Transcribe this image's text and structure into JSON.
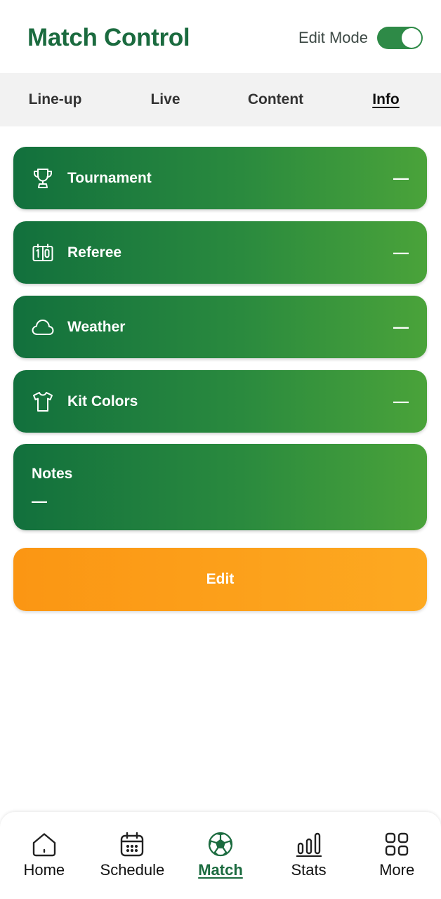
{
  "header": {
    "title": "Match Control",
    "edit_mode_label": "Edit Mode",
    "edit_mode_on": true
  },
  "tabs": [
    {
      "label": "Line-up",
      "active": false
    },
    {
      "label": "Live",
      "active": false
    },
    {
      "label": "Content",
      "active": false
    },
    {
      "label": "Info",
      "active": true
    }
  ],
  "info_cards": [
    {
      "icon": "trophy-icon",
      "label": "Tournament",
      "value": "—"
    },
    {
      "icon": "scoreboard-icon",
      "label": "Referee",
      "value": "—"
    },
    {
      "icon": "cloud-icon",
      "label": "Weather",
      "value": "—"
    },
    {
      "icon": "shirt-icon",
      "label": "Kit Colors",
      "value": "—"
    }
  ],
  "notes": {
    "label": "Notes",
    "value": "—"
  },
  "edit_button_label": "Edit",
  "bottom_nav": [
    {
      "icon": "home-icon",
      "label": "Home",
      "active": false
    },
    {
      "icon": "calendar-icon",
      "label": "Schedule",
      "active": false
    },
    {
      "icon": "soccer-ball-icon",
      "label": "Match",
      "active": true
    },
    {
      "icon": "bar-chart-icon",
      "label": "Stats",
      "active": false
    },
    {
      "icon": "grid-icon",
      "label": "More",
      "active": false
    }
  ],
  "colors": {
    "brand_green": "#1b6b3f",
    "card_gradient_start": "#12703d",
    "card_gradient_end": "#4aa33a",
    "edit_button": "#fb9613",
    "tab_bar_bg": "#f2f2f2"
  }
}
